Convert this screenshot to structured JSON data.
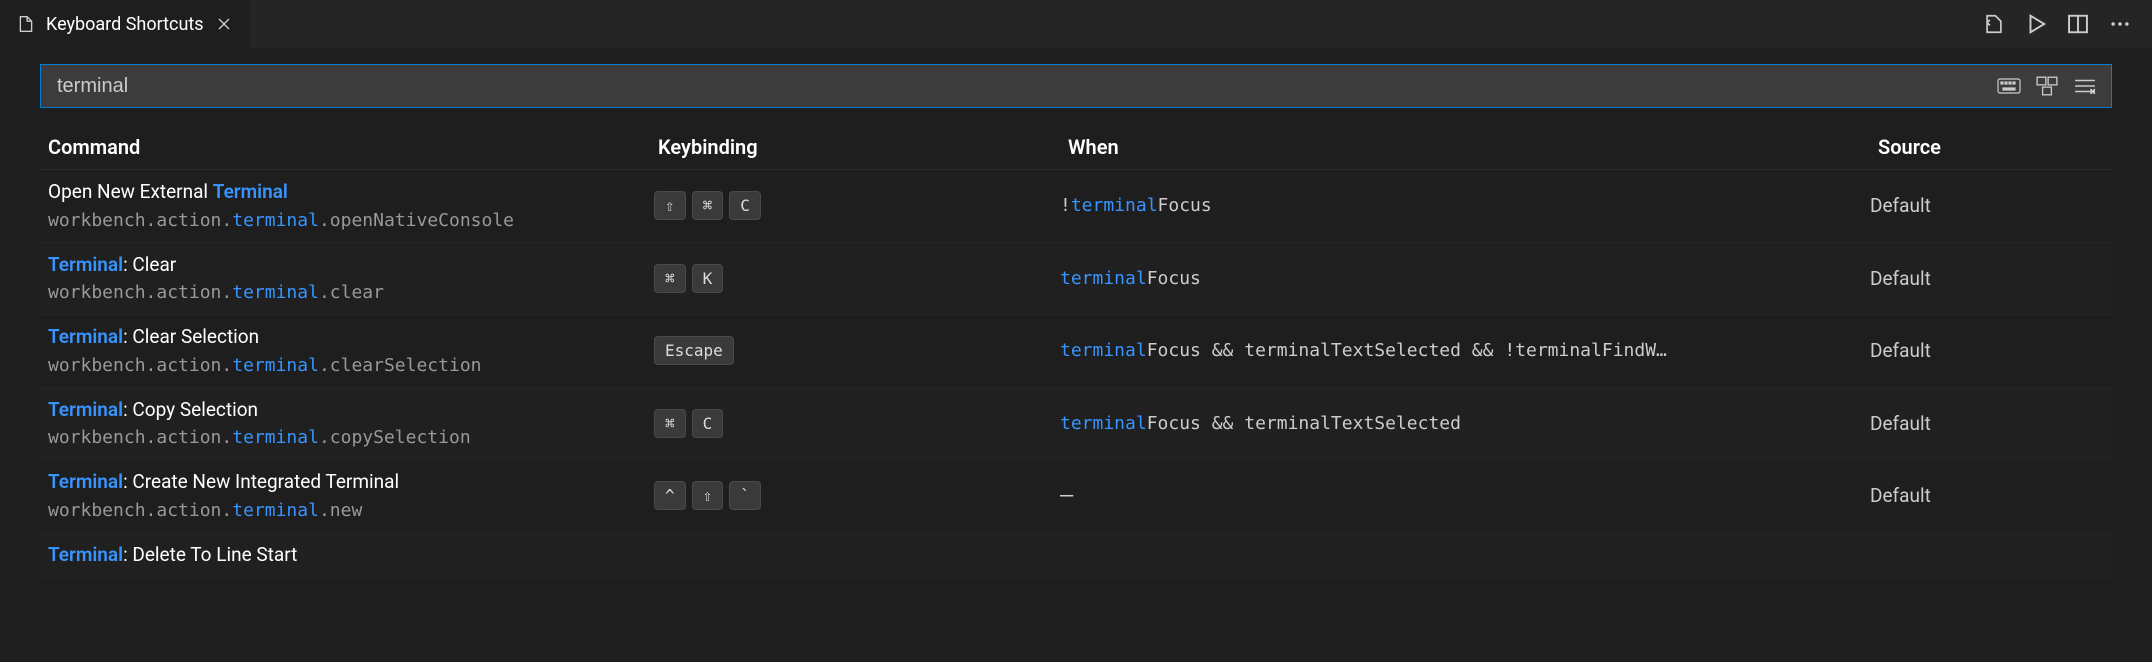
{
  "tab": {
    "title": "Keyboard Shortcuts"
  },
  "search": {
    "value": "terminal"
  },
  "columns": {
    "command": "Command",
    "keybinding": "Keybinding",
    "when": "When",
    "source": "Source"
  },
  "rows": [
    {
      "title_pre": "Open New External ",
      "title_hl": "Terminal",
      "title_post": "",
      "id_pre": "workbench.action.",
      "id_hl": "terminal",
      "id_post": ".openNativeConsole",
      "keys": [
        "⇧",
        "⌘",
        "C"
      ],
      "when_pre": "!",
      "when_hl": "terminal",
      "when_post": "Focus",
      "source": "Default"
    },
    {
      "title_pre": "",
      "title_hl": "Terminal",
      "title_post": ": Clear",
      "id_pre": "workbench.action.",
      "id_hl": "terminal",
      "id_post": ".clear",
      "keys": [
        "⌘",
        "K"
      ],
      "when_pre": "",
      "when_hl": "terminal",
      "when_post": "Focus",
      "source": "Default"
    },
    {
      "title_pre": "",
      "title_hl": "Terminal",
      "title_post": ": Clear Selection",
      "id_pre": "workbench.action.",
      "id_hl": "terminal",
      "id_post": ".clearSelection",
      "keys": [
        "Escape"
      ],
      "when_pre": "",
      "when_hl": "terminal",
      "when_post": "Focus && terminalTextSelected && !terminalFindW…",
      "source": "Default"
    },
    {
      "title_pre": "",
      "title_hl": "Terminal",
      "title_post": ": Copy Selection",
      "id_pre": "workbench.action.",
      "id_hl": "terminal",
      "id_post": ".copySelection",
      "keys": [
        "⌘",
        "C"
      ],
      "when_pre": "",
      "when_hl": "terminal",
      "when_post": "Focus && terminalTextSelected",
      "source": "Default"
    },
    {
      "title_pre": "",
      "title_hl": "Terminal",
      "title_post": ": Create New Integrated Terminal",
      "id_pre": "workbench.action.",
      "id_hl": "terminal",
      "id_post": ".new",
      "keys": [
        "^",
        "⇧",
        "`"
      ],
      "when_pre": "—",
      "when_hl": "",
      "when_post": "",
      "source": "Default"
    },
    {
      "title_pre": "",
      "title_hl": "Terminal",
      "title_post": ": Delete To Line Start",
      "id_pre": "",
      "id_hl": "",
      "id_post": "",
      "keys": [],
      "when_pre": "",
      "when_hl": "",
      "when_post": "",
      "source": ""
    }
  ]
}
